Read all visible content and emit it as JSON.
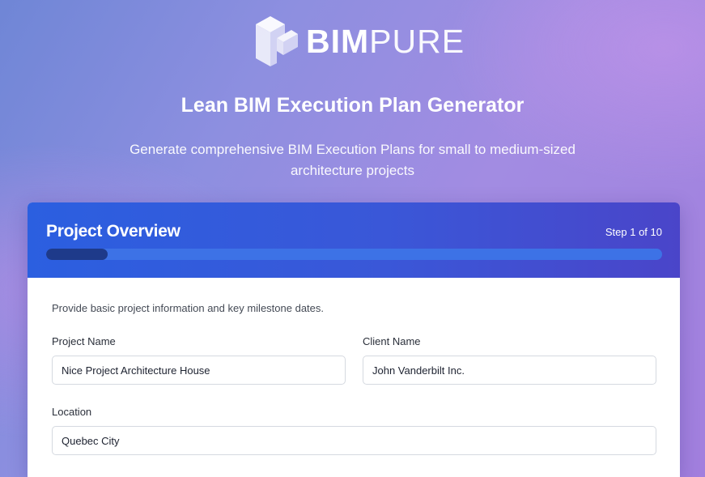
{
  "brand": {
    "bold": "BIM",
    "light": "PURE",
    "logo_icon": "bimpure-cube-icon",
    "color_white": "#ffffff"
  },
  "header": {
    "title": "Lean BIM Execution Plan Generator",
    "subtitle": "Generate comprehensive BIM Execution Plans for small to medium-sized architecture projects"
  },
  "card": {
    "title": "Project Overview",
    "step_text": "Step 1 of 10",
    "progress": 0.1,
    "accent_color": "#2b5fe0",
    "progress_fill_color": "#1e3a8a",
    "intro": "Provide basic project information and key milestone dates.",
    "fields": {
      "project_name": {
        "label": "Project Name",
        "value": "Nice Project Architecture House"
      },
      "client_name": {
        "label": "Client Name",
        "value": "John Vanderbilt Inc."
      },
      "location": {
        "label": "Location",
        "value": "Quebec City"
      }
    }
  }
}
